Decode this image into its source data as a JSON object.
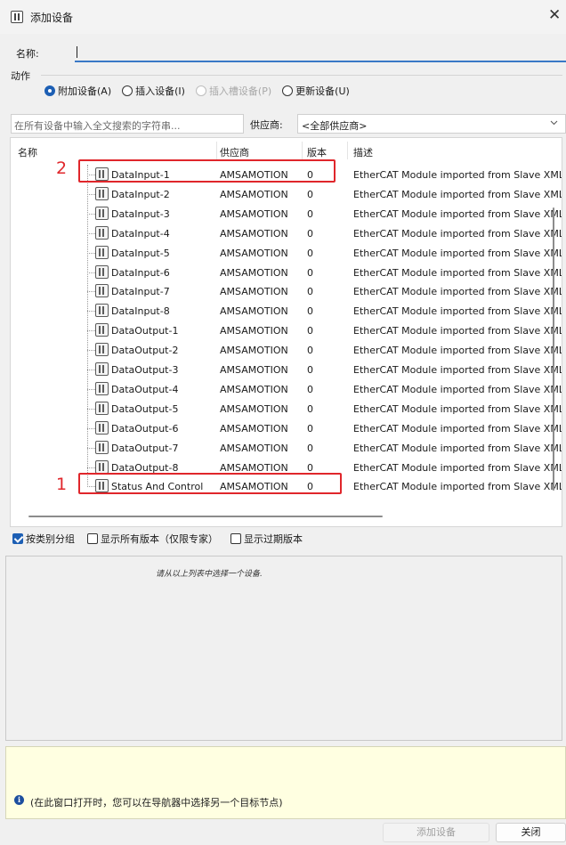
{
  "window": {
    "title": "添加设备",
    "close_glyph": "✕"
  },
  "name_field": {
    "label": "名称:",
    "value": ""
  },
  "action": {
    "label": "动作",
    "options": [
      {
        "label": "附加设备(A)",
        "checked": true,
        "disabled": false
      },
      {
        "label": "插入设备(I)",
        "checked": false,
        "disabled": false
      },
      {
        "label": "插入槽设备(P)",
        "checked": false,
        "disabled": true
      },
      {
        "label": "更新设备(U)",
        "checked": false,
        "disabled": false
      }
    ]
  },
  "search": {
    "placeholder": "在所有设备中输入全文搜索的字符串..."
  },
  "vendor": {
    "label": "供应商:",
    "selected": "<全部供应商>"
  },
  "table": {
    "headers": {
      "name": "名称",
      "vendor": "供应商",
      "version": "版本",
      "description": "描述"
    },
    "rows": [
      {
        "name": "DataInput-1",
        "vendor": "AMSAMOTION",
        "version": "0",
        "description": "EtherCAT Module imported from Slave XML:"
      },
      {
        "name": "DataInput-2",
        "vendor": "AMSAMOTION",
        "version": "0",
        "description": "EtherCAT Module imported from Slave XML:"
      },
      {
        "name": "DataInput-3",
        "vendor": "AMSAMOTION",
        "version": "0",
        "description": "EtherCAT Module imported from Slave XML:"
      },
      {
        "name": "DataInput-4",
        "vendor": "AMSAMOTION",
        "version": "0",
        "description": "EtherCAT Module imported from Slave XML:"
      },
      {
        "name": "DataInput-5",
        "vendor": "AMSAMOTION",
        "version": "0",
        "description": "EtherCAT Module imported from Slave XML:"
      },
      {
        "name": "DataInput-6",
        "vendor": "AMSAMOTION",
        "version": "0",
        "description": "EtherCAT Module imported from Slave XML:"
      },
      {
        "name": "DataInput-7",
        "vendor": "AMSAMOTION",
        "version": "0",
        "description": "EtherCAT Module imported from Slave XML:"
      },
      {
        "name": "DataInput-8",
        "vendor": "AMSAMOTION",
        "version": "0",
        "description": "EtherCAT Module imported from Slave XML:"
      },
      {
        "name": "DataOutput-1",
        "vendor": "AMSAMOTION",
        "version": "0",
        "description": "EtherCAT Module imported from Slave XML:"
      },
      {
        "name": "DataOutput-2",
        "vendor": "AMSAMOTION",
        "version": "0",
        "description": "EtherCAT Module imported from Slave XML:"
      },
      {
        "name": "DataOutput-3",
        "vendor": "AMSAMOTION",
        "version": "0",
        "description": "EtherCAT Module imported from Slave XML:"
      },
      {
        "name": "DataOutput-4",
        "vendor": "AMSAMOTION",
        "version": "0",
        "description": "EtherCAT Module imported from Slave XML:"
      },
      {
        "name": "DataOutput-5",
        "vendor": "AMSAMOTION",
        "version": "0",
        "description": "EtherCAT Module imported from Slave XML:"
      },
      {
        "name": "DataOutput-6",
        "vendor": "AMSAMOTION",
        "version": "0",
        "description": "EtherCAT Module imported from Slave XML:"
      },
      {
        "name": "DataOutput-7",
        "vendor": "AMSAMOTION",
        "version": "0",
        "description": "EtherCAT Module imported from Slave XML:"
      },
      {
        "name": "DataOutput-8",
        "vendor": "AMSAMOTION",
        "version": "0",
        "description": "EtherCAT Module imported from Slave XML:"
      },
      {
        "name": "Status And Control",
        "vendor": "AMSAMOTION",
        "version": "0",
        "description": "EtherCAT Module imported from Slave XML:"
      }
    ]
  },
  "annotations": {
    "marker_2": "2",
    "marker_1": "1",
    "color": "#e0262b"
  },
  "options": {
    "group_by_category": "按类别分组",
    "show_all_versions": "显示所有版本（仅限专家）",
    "show_outdated_versions": "显示过期版本"
  },
  "description_panel": {
    "text": "请从以上列表中选择一个设备."
  },
  "info": {
    "icon": "i",
    "text": "(在此窗口打开时，您可以在导航器中选择另一个目标节点)"
  },
  "buttons": {
    "add": "添加设备",
    "close": "关闭"
  },
  "colors": {
    "accent": "#1d5fb4",
    "info_bg": "#ffffe1"
  }
}
